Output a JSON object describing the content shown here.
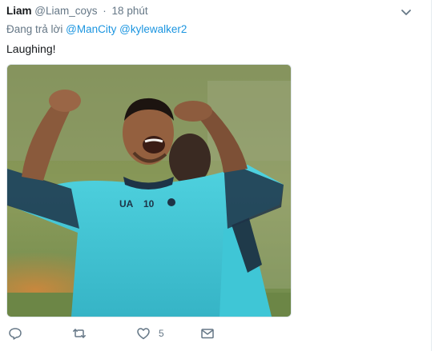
{
  "tweet": {
    "author_name": "Liam",
    "author_handle": "@Liam_coys",
    "separator": "·",
    "timestamp": "18 phút",
    "reply_prefix": "Đang trả lời",
    "reply_mentions": [
      "@ManCity",
      "@kylewalker2"
    ],
    "text": "Laughing!",
    "media_icon": "photo-of-laughing-footballer"
  },
  "actions": {
    "reply_icon": "reply-icon",
    "retweet_icon": "retweet-icon",
    "like_icon": "heart-icon",
    "like_count": "5",
    "dm_icon": "mail-icon"
  },
  "colors": {
    "link": "#1b95e0",
    "secondary": "#657786",
    "primary_text": "#14171a",
    "icon": "#657786"
  }
}
